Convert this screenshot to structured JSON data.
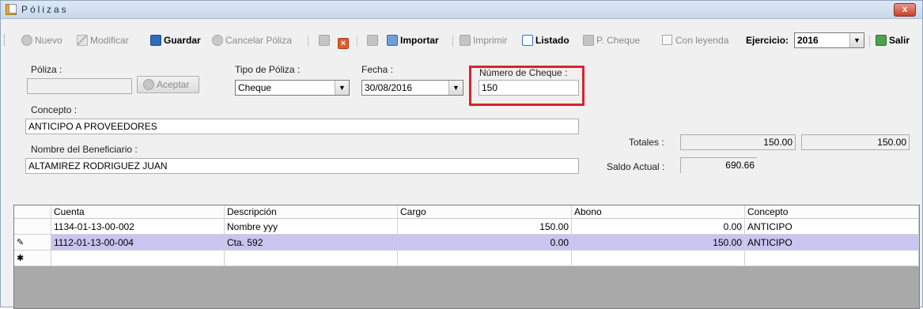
{
  "window": {
    "title": "Pólizas",
    "close_glyph": "x"
  },
  "toolbar": {
    "nuevo": "Nuevo",
    "modificar": "Modificar",
    "guardar": "Guardar",
    "cancelar": "Cancelar Póliza",
    "importar": "Importar",
    "imprimir": "Imprimir",
    "listado": "Listado",
    "p_cheque": "P. Cheque",
    "con_leyenda": "Con leyenda",
    "ejercicio_label": "Ejercicio:",
    "ejercicio_value": "2016",
    "salir": "Salir"
  },
  "form": {
    "poliza_label": "Póliza :",
    "poliza_value": "",
    "aceptar": "Aceptar",
    "tipo_label": "Tipo de Póliza :",
    "tipo_value": "Cheque",
    "fecha_label": "Fecha :",
    "fecha_value": "30/08/2016",
    "cheque_label": "Número de Cheque :",
    "cheque_value": "150",
    "concepto_label": "Concepto :",
    "concepto_value": "ANTICIPO A PROVEEDORES",
    "beneficiario_label": "Nombre del Beneficiario :",
    "beneficiario_value": "ALTAMIREZ RODRIGUEZ JUAN",
    "totales_label": "Totales :",
    "total_cargo": "150.00",
    "total_abono": "150.00",
    "saldo_label": "Saldo Actual :",
    "saldo_value": "690.66"
  },
  "grid": {
    "columns": [
      "Cuenta",
      "Descripción",
      "Cargo",
      "Abono",
      "Concepto"
    ],
    "rows": [
      {
        "indicator": "",
        "cuenta": "1134-01-13-00-002",
        "descripcion": "Nombre yyy",
        "cargo": "150.00",
        "abono": "0.00",
        "concepto": "ANTICIPO"
      },
      {
        "indicator": "✎",
        "cuenta": "1112-01-13-00-004",
        "descripcion": "Cta. 592",
        "cargo": "0.00",
        "abono": "150.00",
        "concepto": "ANTICIPO"
      },
      {
        "indicator": "✱",
        "cuenta": "",
        "descripcion": "",
        "cargo": "",
        "abono": "",
        "concepto": ""
      }
    ]
  },
  "colors": {
    "selected_row": "#c9c5f0",
    "highlight_box": "#d9232e"
  }
}
